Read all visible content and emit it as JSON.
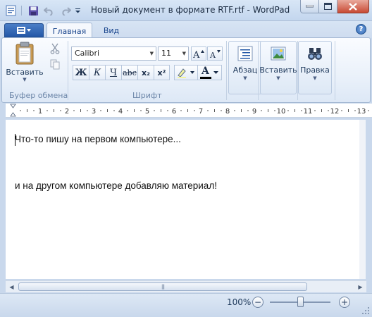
{
  "window": {
    "title": "Новый документ в формате RTF.rtf - WordPad"
  },
  "quick_access": {
    "icons": [
      "wordpad-app-icon",
      "save-icon",
      "undo-icon",
      "redo-icon",
      "customize-dropdown-icon"
    ]
  },
  "ribbon": {
    "tabs": [
      {
        "label": "Главная",
        "selected": true
      },
      {
        "label": "Вид",
        "selected": false
      }
    ],
    "help_label": "?",
    "clipboard": {
      "paste_label": "Вставить",
      "group_label": "Буфер обмена"
    },
    "font": {
      "font_name": "Calibri",
      "font_size": "11",
      "bold_label": "Ж",
      "italic_label": "К",
      "underline_label": "Ч",
      "strike_label": "abc",
      "sub_label": "x₂",
      "sup_label": "x²",
      "color_label": "A",
      "group_label": "Шрифт"
    },
    "paragraph": {
      "label": "Абзац"
    },
    "insert": {
      "label": "Вставить"
    },
    "edit": {
      "label": "Правка"
    }
  },
  "ruler": {
    "numbers": [
      "1",
      "2",
      "3",
      "4",
      "5",
      "6",
      "7",
      "8",
      "9",
      "10",
      "11",
      "12",
      "13"
    ]
  },
  "document": {
    "lines": [
      "Что-то пишу на первом компьютере...",
      "и на другом компьютере добавляю материал!"
    ]
  },
  "status": {
    "zoom_text": "100%",
    "zoom_level_percent": 100,
    "zoom_out_label": "−",
    "zoom_in_label": "+"
  },
  "colors": {
    "accent": "#2458a7",
    "text_color_swatch": "#000000",
    "close_button": "#c84a34"
  }
}
